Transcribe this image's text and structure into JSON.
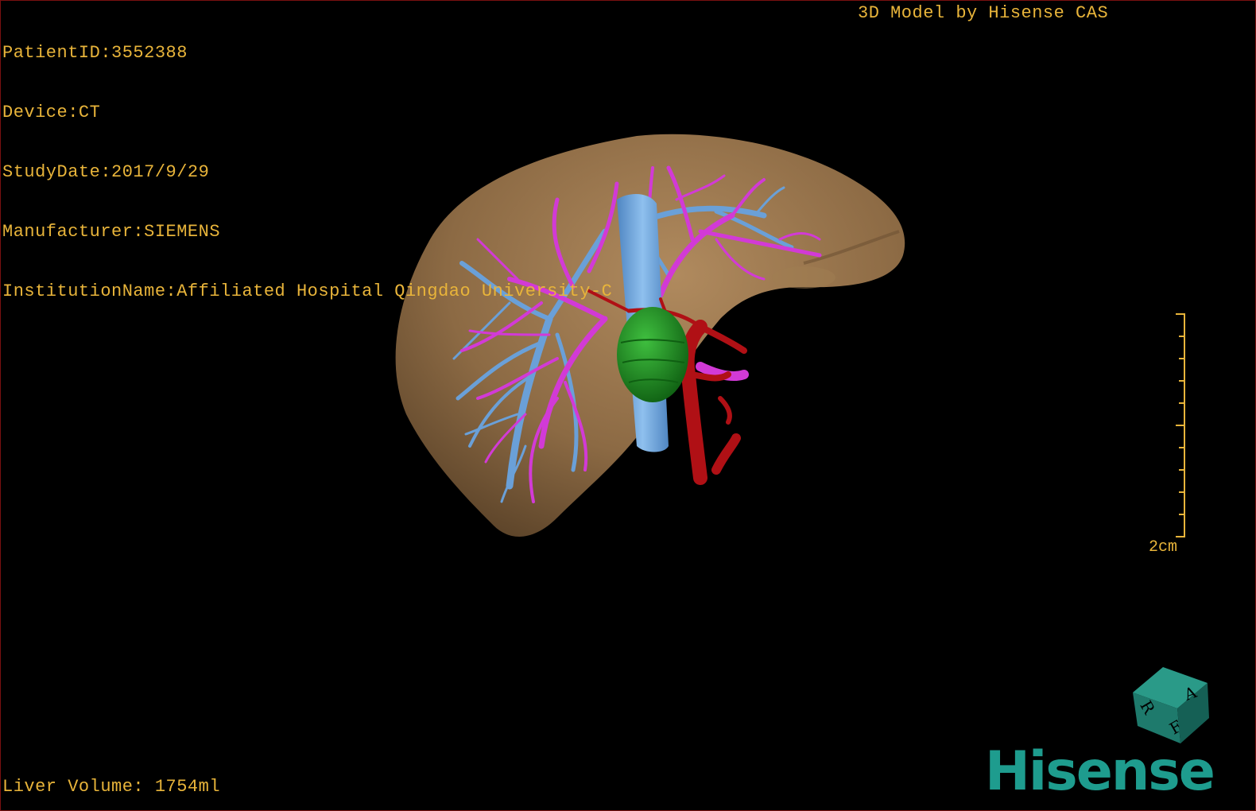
{
  "overlay": {
    "patient_id": "PatientID:3552388",
    "device": "Device:CT",
    "study_date": "StudyDate:2017/9/29",
    "manufacturer": "Manufacturer:SIEMENS",
    "institution": "InstitutionName:Affiliated Hospital Qingdao University-C",
    "model_credit": "3D Model by Hisense CAS",
    "liver_volume": "Liver Volume: 1754ml"
  },
  "scale": {
    "label": "2cm"
  },
  "orientation_cube": {
    "faces": [
      "A",
      "R",
      "F"
    ]
  },
  "brand": {
    "logo_text": "Hisense"
  },
  "colors": {
    "text": "#e8b43a",
    "liver": "#8c6a44",
    "hepatic_vein": "#6aa0d8",
    "portal_vein": "#d23ad6",
    "artery": "#b01015",
    "tumor": "#1f8a1f",
    "cube": "#1e7a6c",
    "brand": "#1e9c8e"
  }
}
